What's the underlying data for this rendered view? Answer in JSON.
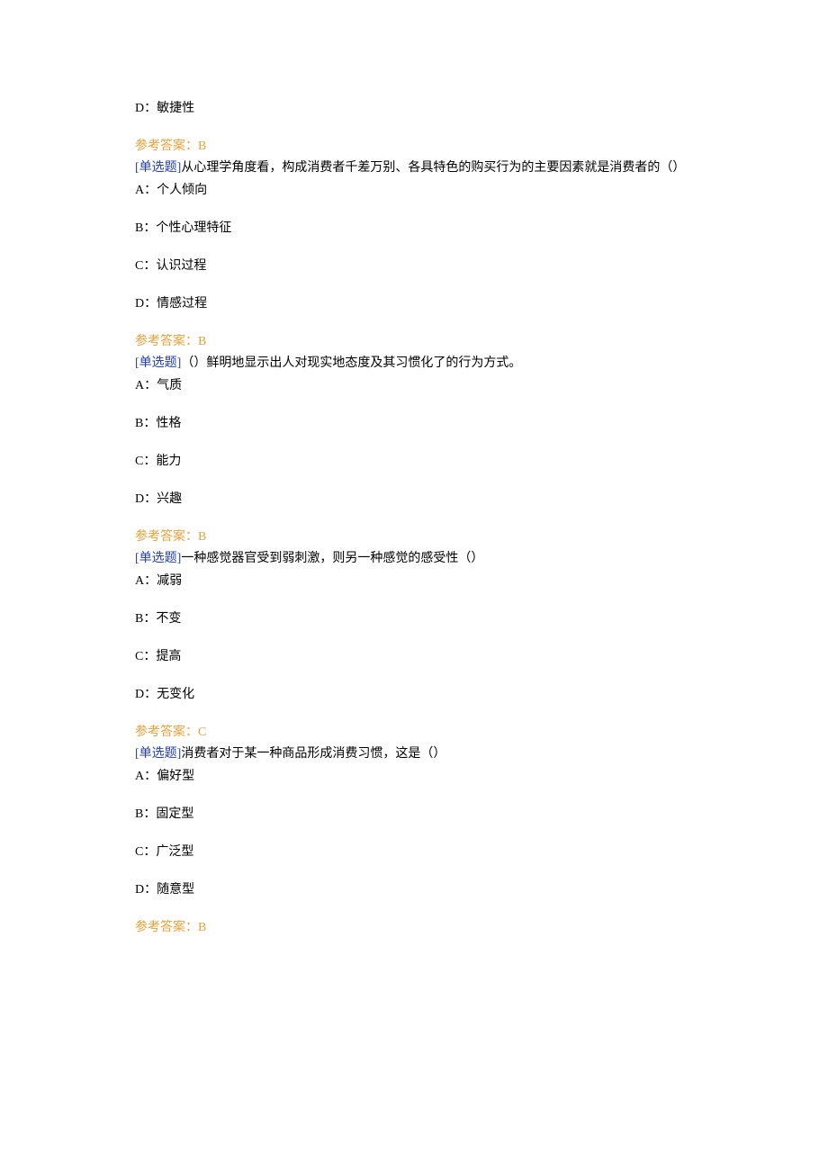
{
  "blocks": [
    {
      "leading_option": "D：敏捷性",
      "answer_label": "参考答案：",
      "answer_value": "B",
      "tag": "[单选题]",
      "question": "从心理学角度看，构成消费者千差万别、各具特色的购买行为的主要因素就是消费者的（）",
      "options": [
        "A：个人倾向",
        "B：个性心理特征",
        "C：认识过程",
        "D：情感过程"
      ]
    },
    {
      "answer_label": "参考答案：",
      "answer_value": "B",
      "tag": "[单选题]",
      "question": "（）鲜明地显示出人对现实地态度及其习惯化了的行为方式。",
      "options": [
        "A：气质",
        "B：性格",
        "C：能力",
        "D：兴趣"
      ]
    },
    {
      "answer_label": "参考答案：",
      "answer_value": "B",
      "tag": "[单选题]",
      "question": "一种感觉器官受到弱刺激，则另一种感觉的感受性（）",
      "options": [
        "A：减弱",
        "B：不变",
        "C：提高",
        "D：无变化"
      ]
    },
    {
      "answer_label": "参考答案：",
      "answer_value": "C",
      "tag": "[单选题]",
      "question": "消费者对于某一种商品形成消费习惯，这是（）",
      "options": [
        "A：偏好型",
        "B：固定型",
        "C：广泛型",
        "D：随意型"
      ]
    },
    {
      "answer_label": "参考答案：",
      "answer_value": "B"
    }
  ]
}
